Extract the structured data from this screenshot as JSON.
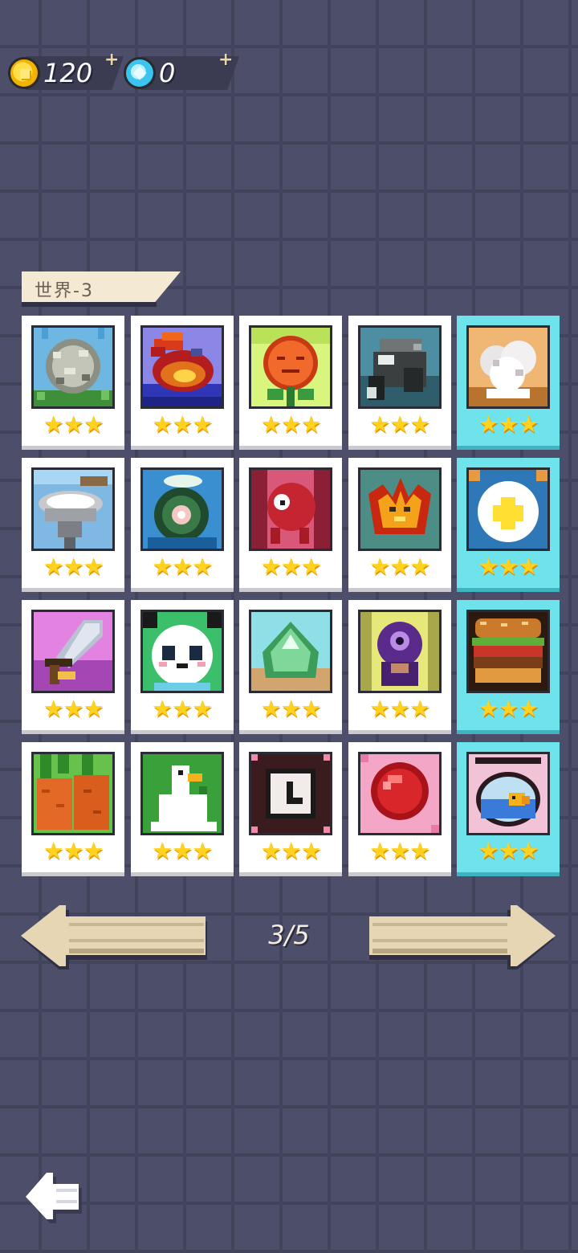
{
  "currency": {
    "coins": "120",
    "gems": "0",
    "add_symbol": "+"
  },
  "world": {
    "title": "世界-3"
  },
  "levels": [
    {
      "stars": "★★★",
      "icon": "tumbleweed-icon",
      "special": false
    },
    {
      "stars": "★★★",
      "icon": "fireball-icon",
      "special": false
    },
    {
      "stars": "★★★",
      "icon": "sunflower-icon",
      "special": false
    },
    {
      "stars": "★★★",
      "icon": "rock-golem-icon",
      "special": false
    },
    {
      "stars": "★★★",
      "icon": "cotton-cloud-icon",
      "special": true
    },
    {
      "stars": "★★★",
      "icon": "wash-basin-icon",
      "special": false
    },
    {
      "stars": "★★★",
      "icon": "lotus-bowl-icon",
      "special": false
    },
    {
      "stars": "★★★",
      "icon": "red-monster-icon",
      "special": false
    },
    {
      "stars": "★★★",
      "icon": "flame-crown-icon",
      "special": false
    },
    {
      "stars": "★★★",
      "icon": "white-flower-icon",
      "special": true
    },
    {
      "stars": "★★★",
      "icon": "sword-icon",
      "special": false
    },
    {
      "stars": "★★★",
      "icon": "panda-icon",
      "special": false
    },
    {
      "stars": "★★★",
      "icon": "green-slime-icon",
      "special": false
    },
    {
      "stars": "★★★",
      "icon": "purple-cyclops-icon",
      "special": false
    },
    {
      "stars": "★★★",
      "icon": "burger-icon",
      "special": true
    },
    {
      "stars": "★★★",
      "icon": "carrot-icon",
      "special": false
    },
    {
      "stars": "★★★",
      "icon": "goose-icon",
      "special": false
    },
    {
      "stars": "★★★",
      "icon": "clock-icon",
      "special": false
    },
    {
      "stars": "★★★",
      "icon": "red-gem-icon",
      "special": false
    },
    {
      "stars": "★★★",
      "icon": "fishbowl-icon",
      "special": true
    }
  ],
  "pagination": {
    "current": "3/5"
  },
  "colors": {
    "background": "#4d4f6a",
    "card": "#ffffff",
    "card_special": "#6fe3ec",
    "star": "#ffd21f",
    "arrow": "#e6d6b4"
  }
}
